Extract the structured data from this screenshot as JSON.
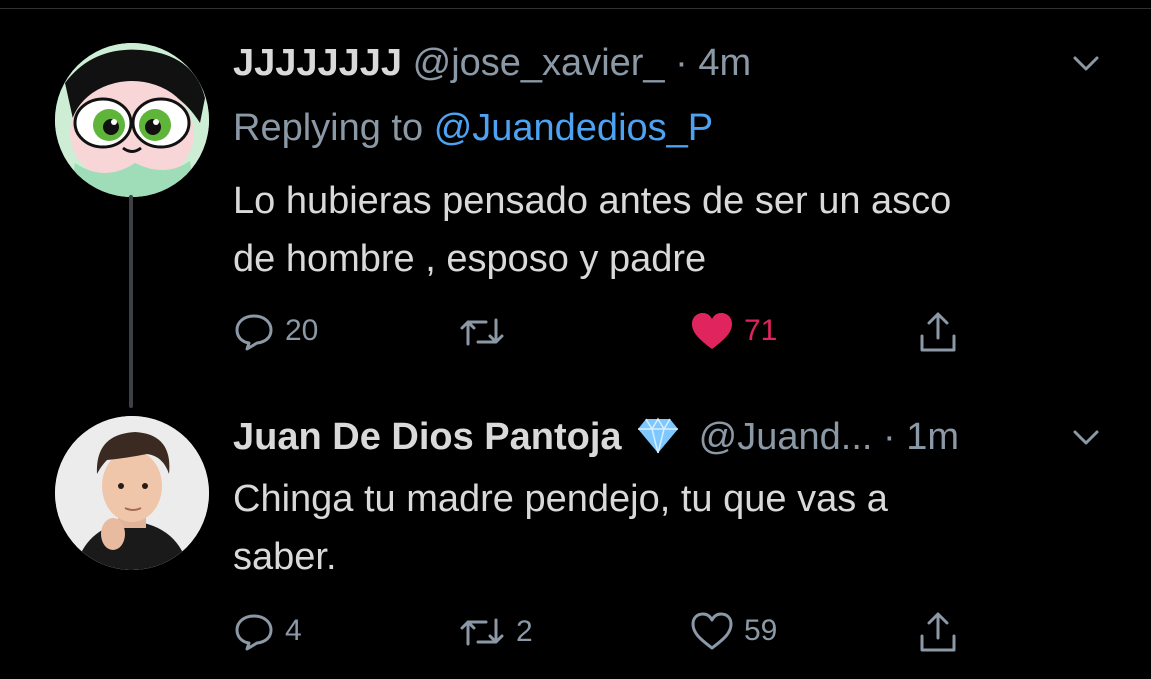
{
  "colors": {
    "background": "#000000",
    "text": "#d9d9d9",
    "muted": "#8b98a5",
    "link": "#4da3f2",
    "like": "#e0245e",
    "verified_gem": "#7ec8ff"
  },
  "tweet1": {
    "avatar_icon": "powerpuff-avatar",
    "display_name": "JJJJJJJJ",
    "handle": "@jose_xavier_",
    "separator": "·",
    "time": "4m",
    "replying_prefix": "Replying to",
    "replying_to": "@Juandedios_P",
    "text_line1": "Lo hubieras pensado antes de ser un asco",
    "text_line2": "de hombre , esposo y padre",
    "replies": "20",
    "retweets": "",
    "likes": "71",
    "liked": true
  },
  "tweet2": {
    "avatar_icon": "person-avatar",
    "display_name": "Juan De Dios Pantoja",
    "badge_icon": "diamond-icon",
    "handle": "@Juand...",
    "separator": "·",
    "time": "1m",
    "text_line1": "Chinga tu madre pendejo, tu que vas a",
    "text_line2": "saber.",
    "replies": "4",
    "retweets": "2",
    "likes": "59",
    "liked": false
  }
}
